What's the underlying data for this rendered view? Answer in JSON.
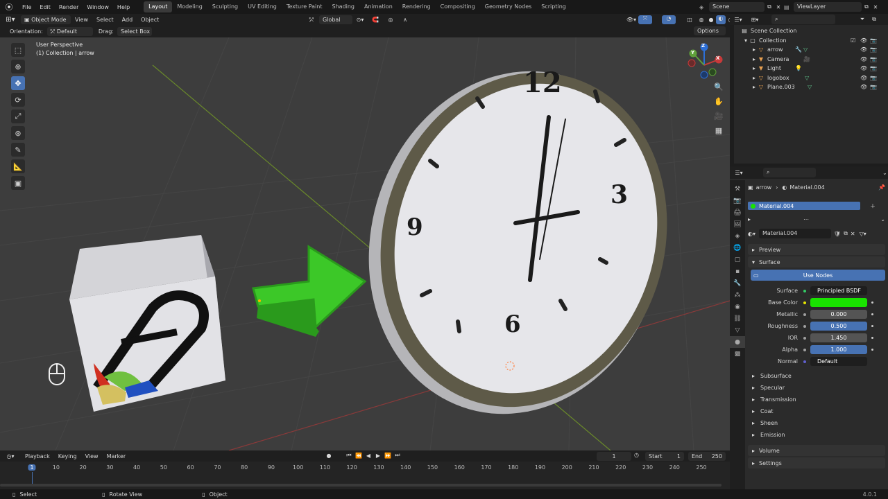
{
  "topbar": {
    "menus": [
      "File",
      "Edit",
      "Render",
      "Window",
      "Help"
    ],
    "workspaces": [
      "Layout",
      "Modeling",
      "Sculpting",
      "UV Editing",
      "Texture Paint",
      "Shading",
      "Animation",
      "Rendering",
      "Compositing",
      "Geometry Nodes",
      "Scripting"
    ],
    "active_workspace": "Layout",
    "scene": "Scene",
    "view_layer": "ViewLayer"
  },
  "vp_header": {
    "mode": "Object Mode",
    "menus": [
      "View",
      "Select",
      "Add",
      "Object"
    ],
    "transform": "Global"
  },
  "tool_settings": {
    "orientation_label": "Orientation:",
    "orientation": "Default",
    "drag_label": "Drag:",
    "drag": "Select Box",
    "options": "Options"
  },
  "viewport": {
    "view_name": "User Perspective",
    "collection_info": "(1) Collection | arrow",
    "clock_numbers": [
      "12",
      "3",
      "6",
      "9"
    ],
    "gizmo": {
      "x": "X",
      "y": "Y",
      "z": "Z"
    }
  },
  "outliner": {
    "root": "Scene Collection",
    "collection": "Collection",
    "items": [
      "arrow",
      "Camera",
      "Light",
      "logobox",
      "Plane.003"
    ]
  },
  "props": {
    "breadcrumb_object": "arrow",
    "breadcrumb_material": "Material.004",
    "slot": "Material.004",
    "material_name": "Material.004",
    "preview": "Preview",
    "surface": "Surface",
    "use_nodes": "Use Nodes",
    "fields": [
      {
        "label": "Surface",
        "value": "Principled BSDF",
        "style": "dark"
      },
      {
        "label": "Base Color",
        "value": "",
        "style": "color",
        "color": "#19e300"
      },
      {
        "label": "Metallic",
        "value": "0.000",
        "style": "grey"
      },
      {
        "label": "Roughness",
        "value": "0.500",
        "style": "blue"
      },
      {
        "label": "IOR",
        "value": "1.450",
        "style": "grey"
      },
      {
        "label": "Alpha",
        "value": "1.000",
        "style": "blue"
      },
      {
        "label": "Normal",
        "value": "Default",
        "style": "dark"
      }
    ],
    "subpanels": [
      "Subsurface",
      "Specular",
      "Transmission",
      "Coat",
      "Sheen",
      "Emission"
    ],
    "volume": "Volume",
    "settings": "Settings"
  },
  "timeline": {
    "menus": [
      "Playback",
      "Keying",
      "View",
      "Marker"
    ],
    "current_frame": "1",
    "start_label": "Start",
    "start": "1",
    "end_label": "End",
    "end": "250",
    "ticks": [
      "1",
      "10",
      "20",
      "30",
      "40",
      "50",
      "60",
      "70",
      "80",
      "90",
      "100",
      "110",
      "120",
      "130",
      "140",
      "150",
      "160",
      "170",
      "180",
      "190",
      "200",
      "210",
      "220",
      "230",
      "240",
      "250"
    ],
    "playhead": "1"
  },
  "status": {
    "select": "Select",
    "rotate": "Rotate View",
    "object": "Object",
    "version": "4.0.1"
  }
}
